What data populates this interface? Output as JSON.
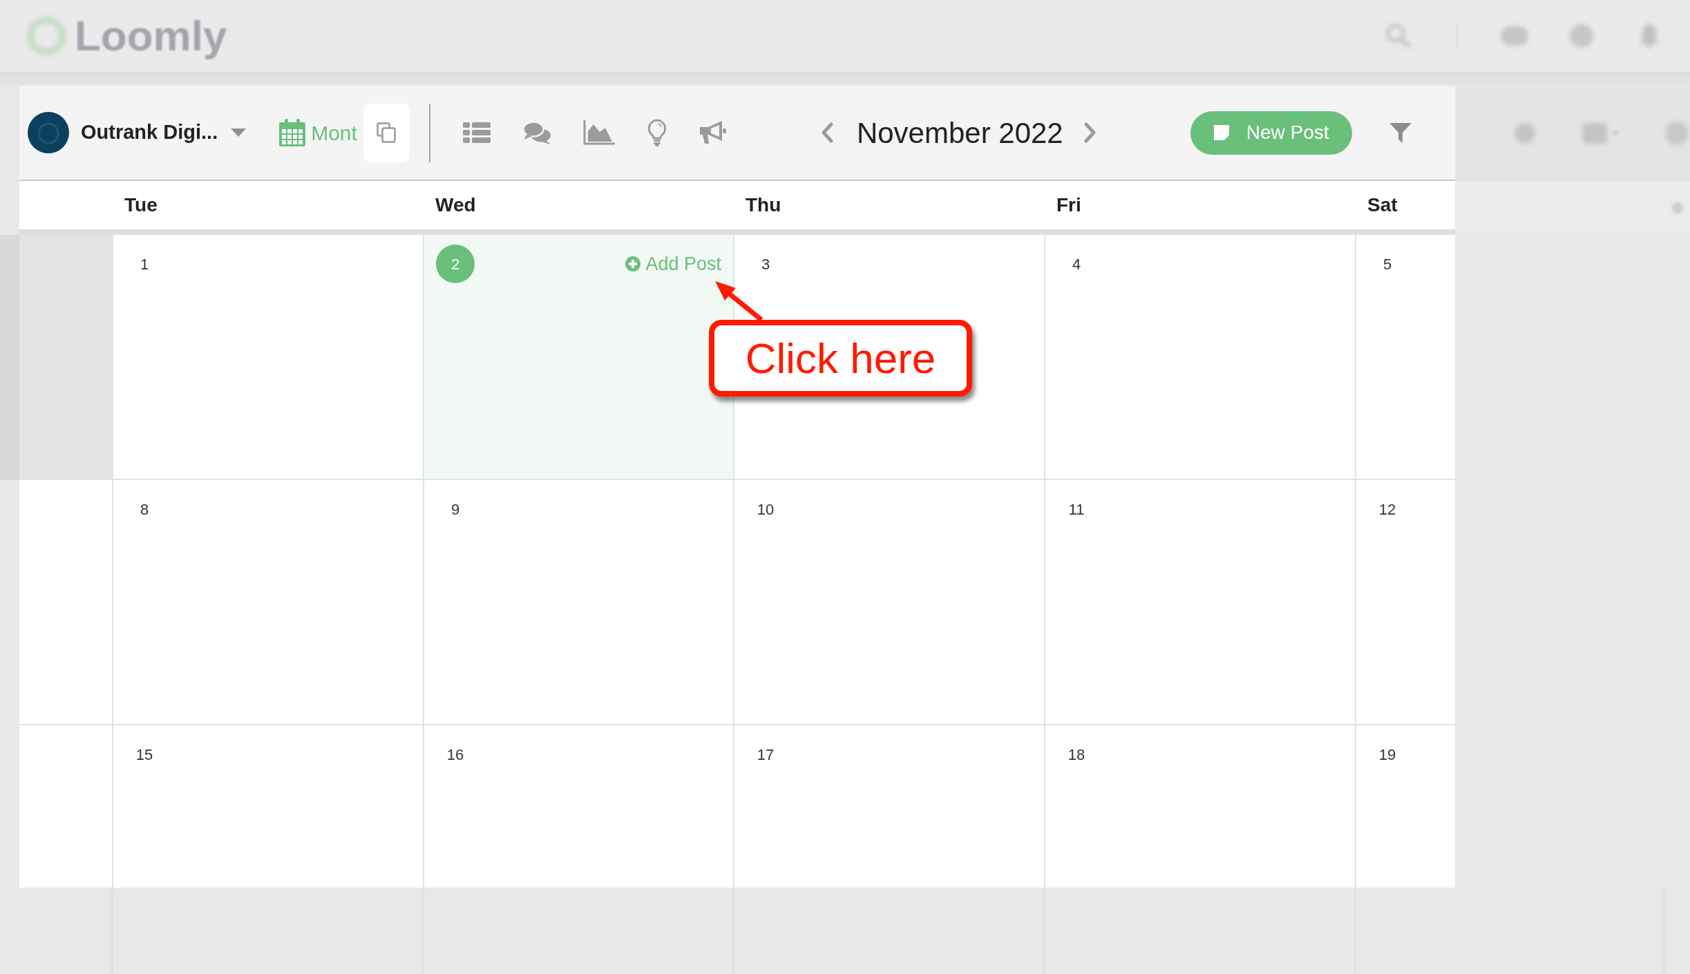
{
  "background": {
    "logo_text": "Loomly"
  },
  "toolbar": {
    "account_name": "Outrank Digi...",
    "month_view": {
      "label": "Mont",
      "selected": true
    },
    "period_title": "November 2022",
    "new_post_label": "New Post"
  },
  "calendar": {
    "weekdays": [
      "Tue",
      "Wed",
      "Thu",
      "Fri",
      "Sat"
    ],
    "weeks": [
      {
        "lead_muted": true,
        "days": [
          {
            "date": "1",
            "today": false
          },
          {
            "date": "2",
            "today": true,
            "add_post": "Add Post"
          },
          {
            "date": "3",
            "today": false
          },
          {
            "date": "4",
            "today": false
          },
          {
            "date": "5",
            "today": false
          }
        ]
      },
      {
        "lead_muted": false,
        "days": [
          {
            "date": "8",
            "today": false
          },
          {
            "date": "9",
            "today": false
          },
          {
            "date": "10",
            "today": false
          },
          {
            "date": "11",
            "today": false
          },
          {
            "date": "12",
            "today": false
          }
        ]
      },
      {
        "lead_muted": false,
        "days": [
          {
            "date": "15",
            "today": false
          },
          {
            "date": "16",
            "today": false
          },
          {
            "date": "17",
            "today": false
          },
          {
            "date": "18",
            "today": false
          },
          {
            "date": "19",
            "today": false
          }
        ]
      }
    ]
  },
  "annotation": {
    "text": "Click here"
  }
}
